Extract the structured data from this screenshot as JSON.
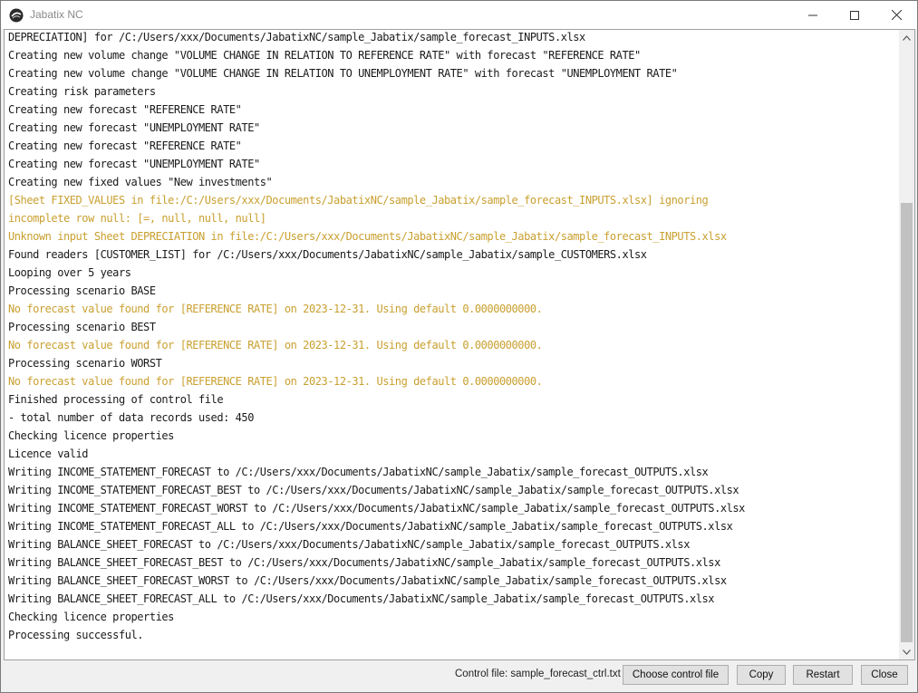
{
  "window": {
    "title": "Jabatix NC"
  },
  "log": {
    "lines": [
      {
        "text": "DEPRECIATION] for /C:/Users/xxx/Documents/JabatixNC/sample_Jabatix/sample_forecast_INPUTS.xlsx",
        "level": "info"
      },
      {
        "text": "Creating new volume change \"VOLUME CHANGE IN RELATION TO REFERENCE RATE\" with forecast \"REFERENCE RATE\"",
        "level": "info"
      },
      {
        "text": "Creating new volume change \"VOLUME CHANGE IN RELATION TO UNEMPLOYMENT RATE\" with forecast \"UNEMPLOYMENT RATE\"",
        "level": "info"
      },
      {
        "text": "Creating risk parameters",
        "level": "info"
      },
      {
        "text": "Creating new forecast \"REFERENCE RATE\"",
        "level": "info"
      },
      {
        "text": "Creating new forecast \"UNEMPLOYMENT RATE\"",
        "level": "info"
      },
      {
        "text": "Creating new forecast \"REFERENCE RATE\"",
        "level": "info"
      },
      {
        "text": "Creating new forecast \"UNEMPLOYMENT RATE\"",
        "level": "info"
      },
      {
        "text": "Creating new fixed values \"New investments\"",
        "level": "info"
      },
      {
        "text": "[Sheet FIXED_VALUES in file:/C:/Users/xxx/Documents/JabatixNC/sample_Jabatix/sample_forecast_INPUTS.xlsx] ignoring",
        "level": "warn"
      },
      {
        "text": "incomplete row null: [=, null, null, null]",
        "level": "warn"
      },
      {
        "text": "Unknown input Sheet DEPRECIATION in file:/C:/Users/xxx/Documents/JabatixNC/sample_Jabatix/sample_forecast_INPUTS.xlsx",
        "level": "warn"
      },
      {
        "text": "Found readers [CUSTOMER_LIST] for /C:/Users/xxx/Documents/JabatixNC/sample_Jabatix/sample_CUSTOMERS.xlsx",
        "level": "info"
      },
      {
        "text": "Looping over 5 years",
        "level": "info"
      },
      {
        "text": "Processing scenario BASE",
        "level": "info"
      },
      {
        "text": "No forecast value found for [REFERENCE RATE] on 2023-12-31. Using default 0.0000000000.",
        "level": "warn"
      },
      {
        "text": "Processing scenario BEST",
        "level": "info"
      },
      {
        "text": "No forecast value found for [REFERENCE RATE] on 2023-12-31. Using default 0.0000000000.",
        "level": "warn"
      },
      {
        "text": "Processing scenario WORST",
        "level": "info"
      },
      {
        "text": "No forecast value found for [REFERENCE RATE] on 2023-12-31. Using default 0.0000000000.",
        "level": "warn"
      },
      {
        "text": "Finished processing of control file",
        "level": "info"
      },
      {
        "text": "- total number of data records used: 450",
        "level": "info"
      },
      {
        "text": "Checking licence properties",
        "level": "info"
      },
      {
        "text": "Licence valid",
        "level": "info"
      },
      {
        "text": "Writing INCOME_STATEMENT_FORECAST to /C:/Users/xxx/Documents/JabatixNC/sample_Jabatix/sample_forecast_OUTPUTS.xlsx",
        "level": "info"
      },
      {
        "text": "Writing INCOME_STATEMENT_FORECAST_BEST to /C:/Users/xxx/Documents/JabatixNC/sample_Jabatix/sample_forecast_OUTPUTS.xlsx",
        "level": "info"
      },
      {
        "text": "Writing INCOME_STATEMENT_FORECAST_WORST to /C:/Users/xxx/Documents/JabatixNC/sample_Jabatix/sample_forecast_OUTPUTS.xlsx",
        "level": "info"
      },
      {
        "text": "Writing INCOME_STATEMENT_FORECAST_ALL to /C:/Users/xxx/Documents/JabatixNC/sample_Jabatix/sample_forecast_OUTPUTS.xlsx",
        "level": "info"
      },
      {
        "text": "Writing BALANCE_SHEET_FORECAST to /C:/Users/xxx/Documents/JabatixNC/sample_Jabatix/sample_forecast_OUTPUTS.xlsx",
        "level": "info"
      },
      {
        "text": "Writing BALANCE_SHEET_FORECAST_BEST to /C:/Users/xxx/Documents/JabatixNC/sample_Jabatix/sample_forecast_OUTPUTS.xlsx",
        "level": "info"
      },
      {
        "text": "Writing BALANCE_SHEET_FORECAST_WORST to /C:/Users/xxx/Documents/JabatixNC/sample_Jabatix/sample_forecast_OUTPUTS.xlsx",
        "level": "info"
      },
      {
        "text": "Writing BALANCE_SHEET_FORECAST_ALL to /C:/Users/xxx/Documents/JabatixNC/sample_Jabatix/sample_forecast_OUTPUTS.xlsx",
        "level": "info"
      },
      {
        "text": "Checking licence properties",
        "level": "info"
      },
      {
        "text": "Processing successful.",
        "level": "info"
      }
    ]
  },
  "footer": {
    "control_file_label": "Control file: sample_forecast_ctrl.txt",
    "choose_label": "Choose control file",
    "copy_label": "Copy",
    "restart_label": "Restart",
    "close_label": "Close"
  },
  "colors": {
    "warn_text": "#c9a030",
    "info_text": "#1a1a1a"
  }
}
